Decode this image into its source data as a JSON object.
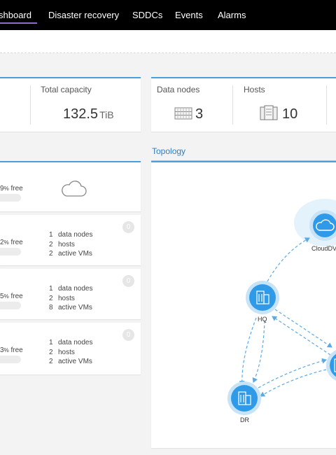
{
  "nav": {
    "tabs": [
      {
        "label": "shboard",
        "active": true
      },
      {
        "label": "Disaster recovery"
      },
      {
        "label": "SDDCs"
      },
      {
        "label": "Events"
      },
      {
        "label": "Alarms"
      }
    ]
  },
  "summary": {
    "total_capacity_label": "Total capacity",
    "total_capacity_value": "132.5",
    "total_capacity_unit": "TiB",
    "data_nodes_label": "Data nodes",
    "data_nodes_value": "3",
    "hosts_label": "Hosts",
    "hosts_value": "10"
  },
  "topology": {
    "title": "Topology",
    "nodes": [
      {
        "label": "CloudDV"
      },
      {
        "label": "HQ"
      },
      {
        "label": "DR"
      }
    ]
  },
  "sites": [
    {
      "free_num": "9",
      "free_pct": "%",
      "free_word": "free"
    },
    {
      "free_num": "2",
      "free_pct": "%",
      "free_word": "free",
      "badge": "0",
      "data_nodes": "1",
      "data_nodes_label": "data nodes",
      "hosts": "2",
      "hosts_label": "hosts",
      "vms": "2",
      "vms_label": "active VMs"
    },
    {
      "free_num": "5",
      "free_pct": "%",
      "free_word": "free",
      "badge": "0",
      "data_nodes": "1",
      "data_nodes_label": "data nodes",
      "hosts": "2",
      "hosts_label": "hosts",
      "vms": "8",
      "vms_label": "active VMs"
    },
    {
      "free_num": "3",
      "free_pct": "%",
      "free_word": "free",
      "badge": "0",
      "data_nodes": "1",
      "data_nodes_label": "data nodes",
      "hosts": "2",
      "hosts_label": "hosts",
      "vms": "2",
      "vms_label": "active VMs"
    }
  ],
  "colors": {
    "nav_bg": "#000000",
    "accent": "#4a9fd8",
    "active_tab_underline": "#8b6cc9",
    "node_fill": "#2f9be8"
  },
  "icons": [
    "cloud-icon",
    "data-node-icon",
    "hosts-icon",
    "building-icon"
  ]
}
